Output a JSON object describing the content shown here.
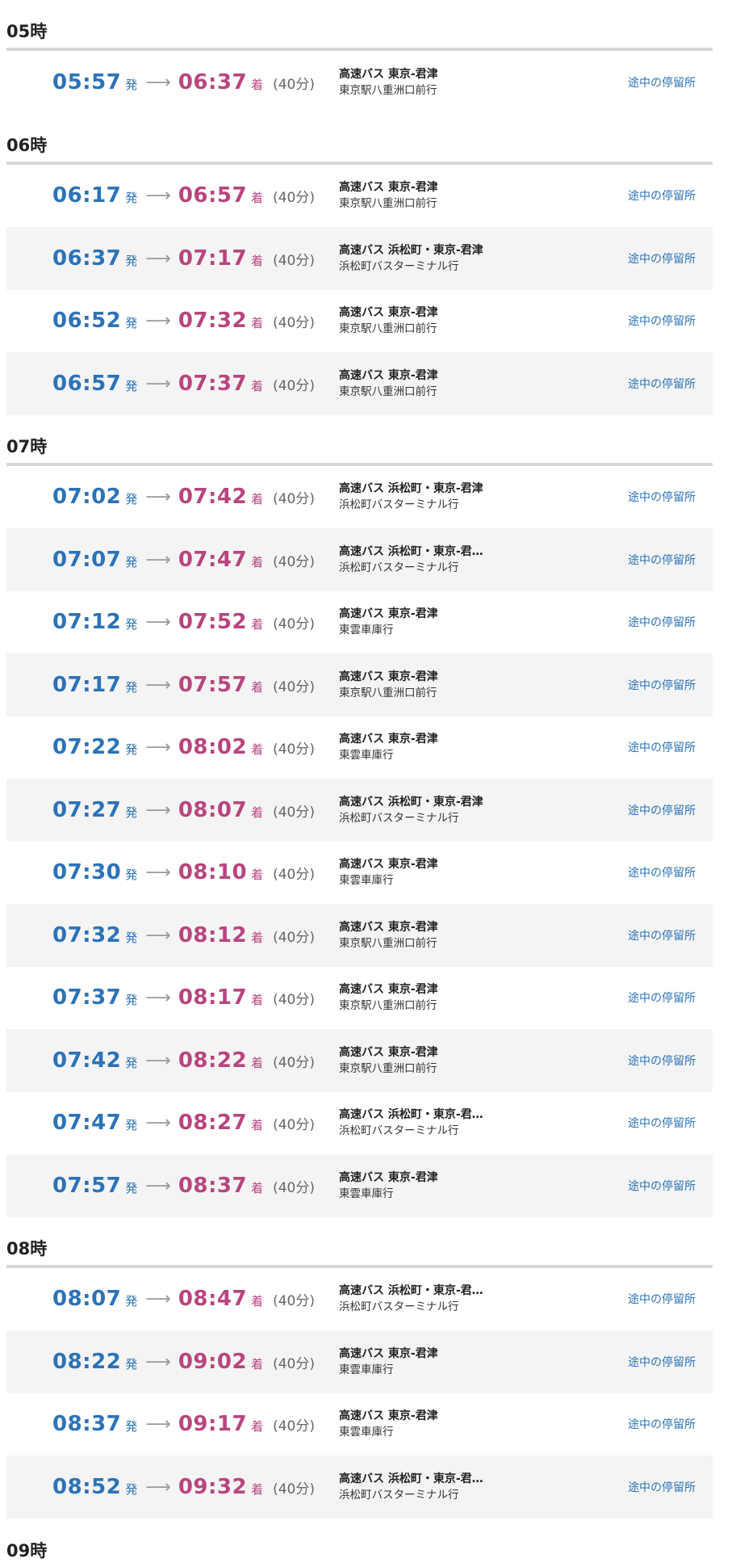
{
  "labels": {
    "dep_suffix": "発",
    "arr_suffix": "着",
    "arrow": "⟶",
    "stops_link": "途中の停留所"
  },
  "hours": [
    {
      "heading": "05時",
      "rows": [
        {
          "dep": "05:57",
          "arr": "06:37",
          "duration": "(40分)",
          "route": "高速バス 東京-君津",
          "dest": "東京駅八重洲口前行"
        }
      ]
    },
    {
      "heading": "06時",
      "rows": [
        {
          "dep": "06:17",
          "arr": "06:57",
          "duration": "(40分)",
          "route": "高速バス 東京-君津",
          "dest": "東京駅八重洲口前行"
        },
        {
          "dep": "06:37",
          "arr": "07:17",
          "duration": "(40分)",
          "route": "高速バス 浜松町・東京-君津",
          "dest": "浜松町バスターミナル行"
        },
        {
          "dep": "06:52",
          "arr": "07:32",
          "duration": "(40分)",
          "route": "高速バス 東京-君津",
          "dest": "東京駅八重洲口前行"
        },
        {
          "dep": "06:57",
          "arr": "07:37",
          "duration": "(40分)",
          "route": "高速バス 東京-君津",
          "dest": "東京駅八重洲口前行"
        }
      ]
    },
    {
      "heading": "07時",
      "rows": [
        {
          "dep": "07:02",
          "arr": "07:42",
          "duration": "(40分)",
          "route": "高速バス 浜松町・東京-君津",
          "dest": "浜松町バスターミナル行"
        },
        {
          "dep": "07:07",
          "arr": "07:47",
          "duration": "(40分)",
          "route": "高速バス 浜松町・東京-君…",
          "dest": "浜松町バスターミナル行"
        },
        {
          "dep": "07:12",
          "arr": "07:52",
          "duration": "(40分)",
          "route": "高速バス 東京-君津",
          "dest": "東雲車庫行"
        },
        {
          "dep": "07:17",
          "arr": "07:57",
          "duration": "(40分)",
          "route": "高速バス 東京-君津",
          "dest": "東京駅八重洲口前行"
        },
        {
          "dep": "07:22",
          "arr": "08:02",
          "duration": "(40分)",
          "route": "高速バス 東京-君津",
          "dest": "東雲車庫行"
        },
        {
          "dep": "07:27",
          "arr": "08:07",
          "duration": "(40分)",
          "route": "高速バス 浜松町・東京-君津",
          "dest": "浜松町バスターミナル行"
        },
        {
          "dep": "07:30",
          "arr": "08:10",
          "duration": "(40分)",
          "route": "高速バス 東京-君津",
          "dest": "東雲車庫行"
        },
        {
          "dep": "07:32",
          "arr": "08:12",
          "duration": "(40分)",
          "route": "高速バス 東京-君津",
          "dest": "東京駅八重洲口前行"
        },
        {
          "dep": "07:37",
          "arr": "08:17",
          "duration": "(40分)",
          "route": "高速バス 東京-君津",
          "dest": "東京駅八重洲口前行"
        },
        {
          "dep": "07:42",
          "arr": "08:22",
          "duration": "(40分)",
          "route": "高速バス 東京-君津",
          "dest": "東京駅八重洲口前行"
        },
        {
          "dep": "07:47",
          "arr": "08:27",
          "duration": "(40分)",
          "route": "高速バス 浜松町・東京-君…",
          "dest": "浜松町バスターミナル行"
        },
        {
          "dep": "07:57",
          "arr": "08:37",
          "duration": "(40分)",
          "route": "高速バス 東京-君津",
          "dest": "東雲車庫行"
        }
      ]
    },
    {
      "heading": "08時",
      "rows": [
        {
          "dep": "08:07",
          "arr": "08:47",
          "duration": "(40分)",
          "route": "高速バス 浜松町・東京-君…",
          "dest": "浜松町バスターミナル行"
        },
        {
          "dep": "08:22",
          "arr": "09:02",
          "duration": "(40分)",
          "route": "高速バス 東京-君津",
          "dest": "東雲車庫行"
        },
        {
          "dep": "08:37",
          "arr": "09:17",
          "duration": "(40分)",
          "route": "高速バス 東京-君津",
          "dest": "東雲車庫行"
        },
        {
          "dep": "08:52",
          "arr": "09:32",
          "duration": "(40分)",
          "route": "高速バス 浜松町・東京-君…",
          "dest": "浜松町バスターミナル行"
        }
      ]
    },
    {
      "heading": "09時",
      "rows": []
    }
  ]
}
